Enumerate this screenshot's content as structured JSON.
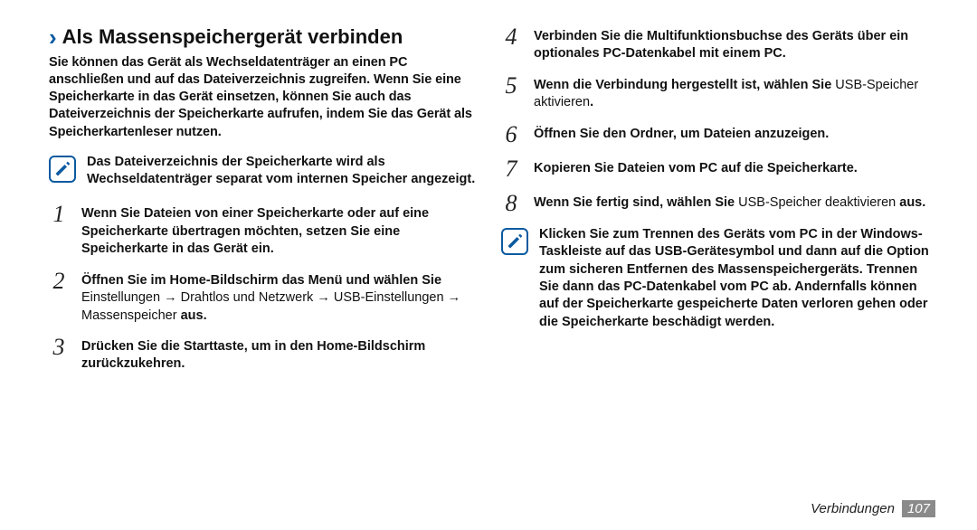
{
  "heading": "Als Massenspeichergerät verbinden",
  "intro": "Sie können das Gerät als Wechseldatenträger an einen PC anschließen und auf das Dateiverzeichnis zugreifen. Wenn Sie eine Speicherkarte in das Gerät einsetzen, können Sie auch das Dateiverzeichnis der Speicherkarte aufrufen, indem Sie das Gerät als Speicherkartenleser nutzen.",
  "note_left": {
    "bold": "Das Dateiverzeichnis der Speicherkarte wird als Wechseldatenträger separat vom internen Speicher angezeigt."
  },
  "steps_left": [
    {
      "num": "1",
      "bold": "Wenn Sie Dateien von einer Speicherkarte oder auf eine Speicherkarte übertragen möchten, setzen Sie eine Speicherkarte in das Gerät ein."
    },
    {
      "num": "2",
      "bold_a": "Öffnen Sie im Home-Bildschirm das Menü und wählen Sie ",
      "light_a": "Einstellungen   →   Drahtlos und Netzwerk   →   USB-Einstellungen   →   Massenspeicher ",
      "bold_b": "aus."
    },
    {
      "num": "3",
      "bold": "Drücken Sie die Starttaste, um in den Home-Bildschirm zurückzukehren."
    }
  ],
  "steps_right": [
    {
      "num": "4",
      "bold": "Verbinden Sie die Multifunktionsbuchse des Geräts über ein optionales PC-Datenkabel mit einem PC."
    },
    {
      "num": "5",
      "bold_a": "Wenn die Verbindung hergestellt ist, wählen Sie ",
      "light_a": "USB-Speicher aktivieren",
      "bold_b": "."
    },
    {
      "num": "6",
      "bold": "Öffnen Sie den Ordner, um Dateien anzuzeigen."
    },
    {
      "num": "7",
      "bold": "Kopieren Sie Dateien vom PC auf die Speicherkarte."
    },
    {
      "num": "8",
      "bold_a": "Wenn Sie fertig sind, wählen Sie ",
      "light_a": "USB-Speicher deaktivieren ",
      "bold_b": "aus."
    }
  ],
  "note_right": {
    "bold": "Klicken Sie zum Trennen des Geräts vom PC in der Windows-Taskleiste auf das USB-Gerätesymbol und dann auf die Option zum sicheren Entfernen des Massenspeichergeräts. Trennen Sie dann das PC-Datenkabel vom PC ab. Andernfalls können auf der Speicherkarte gespeicherte Daten verloren gehen oder die Speicherkarte beschädigt werden."
  },
  "footer": {
    "label": "Verbindungen",
    "page": "107"
  }
}
